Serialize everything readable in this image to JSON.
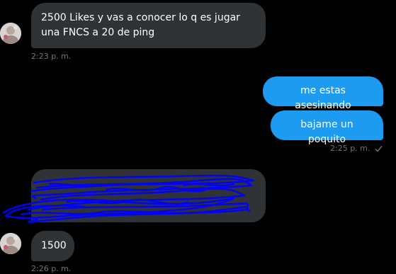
{
  "thread": {
    "messages": [
      {
        "direction": "incoming",
        "text": "2500 Likes y vas a conocer lo q es jugar una FNCS a 20 de ping",
        "time": "2:23 p. m."
      },
      {
        "direction": "outgoing",
        "text": "me estas asesinando"
      },
      {
        "direction": "outgoing",
        "text": "bajame un poquito",
        "time": "2:25 p. m.",
        "status_icon": "check-icon"
      },
      {
        "direction": "incoming",
        "redacted": true,
        "scribble_color": "#0000ff"
      },
      {
        "direction": "incoming",
        "text": "1500",
        "time": "2:26 p. m."
      }
    ]
  },
  "colors": {
    "background": "#000000",
    "incoming_bubble": "#2f3336",
    "outgoing_bubble": "#1d9bf0",
    "timestamp": "#71767b"
  }
}
